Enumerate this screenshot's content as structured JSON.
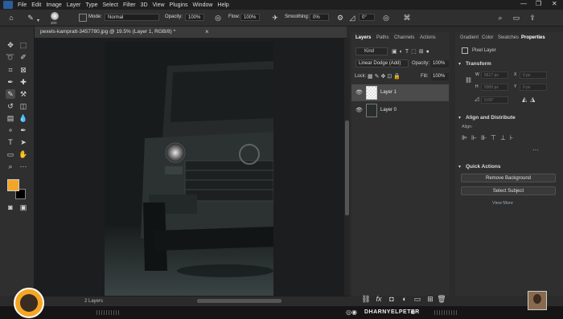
{
  "menu": [
    "File",
    "Edit",
    "Image",
    "Layer",
    "Type",
    "Select",
    "Filter",
    "3D",
    "View",
    "Plugins",
    "Window",
    "Help"
  ],
  "window_controls": {
    "minimize": "—",
    "maximize": "❐",
    "close": "✕"
  },
  "options": {
    "brush_size": "300",
    "mode_label": "Mode:",
    "mode_value": "Normal",
    "opacity_label": "Opacity:",
    "opacity_value": "100%",
    "flow_label": "Flow:",
    "flow_value": "100%",
    "smoothing_label": "Smoothing:",
    "smoothing_value": "0%",
    "angle_value": "0°"
  },
  "document": {
    "tab_title": "pexels-kampratt-3457780.jpg @ 19.5% (Layer 1, RGB/8) *",
    "close_glyph": "×"
  },
  "status": {
    "layers_count": "2 Layers"
  },
  "layers_panel": {
    "tabs": [
      "Layers",
      "Paths",
      "Channels",
      "Actions"
    ],
    "kind_label": "Kind",
    "blend_mode": "Linear Dodge (Add)",
    "opacity_label": "Opacity:",
    "opacity_value": "100%",
    "lock_label": "Lock:",
    "fill_label": "Fill:",
    "fill_value": "100%",
    "layers": [
      {
        "name": "Layer 1",
        "selected": true
      },
      {
        "name": "Layer 0",
        "selected": false
      }
    ],
    "bottom_icons": [
      "link-icon",
      "fx-icon",
      "mask-icon",
      "adjustment-icon",
      "group-icon",
      "new-layer-icon",
      "trash-icon"
    ]
  },
  "properties_panel": {
    "tabs": [
      "Gradient",
      "Color",
      "Swatches",
      "Properties"
    ],
    "pixel_layer_label": "Pixel Layer",
    "transform_label": "Transform",
    "w_label": "W",
    "w_value": "5617 px",
    "h_label": "H",
    "h_value": "5000 px",
    "x_label": "X",
    "x_value": "0 px",
    "y_label": "Y",
    "y_value": "0 px",
    "angle_value": "0.00°",
    "align_label": "Align and Distribute",
    "align_sub": "Align:",
    "quick_actions_label": "Quick Actions",
    "remove_bg": "Remove Background",
    "select_subject": "Select Subject",
    "view_more": "View More"
  },
  "footer": {
    "brand": "DHARNYELPETER"
  },
  "colors": {
    "foreground": "#f3a526",
    "background": "#000000",
    "accent": "#f5a623"
  }
}
